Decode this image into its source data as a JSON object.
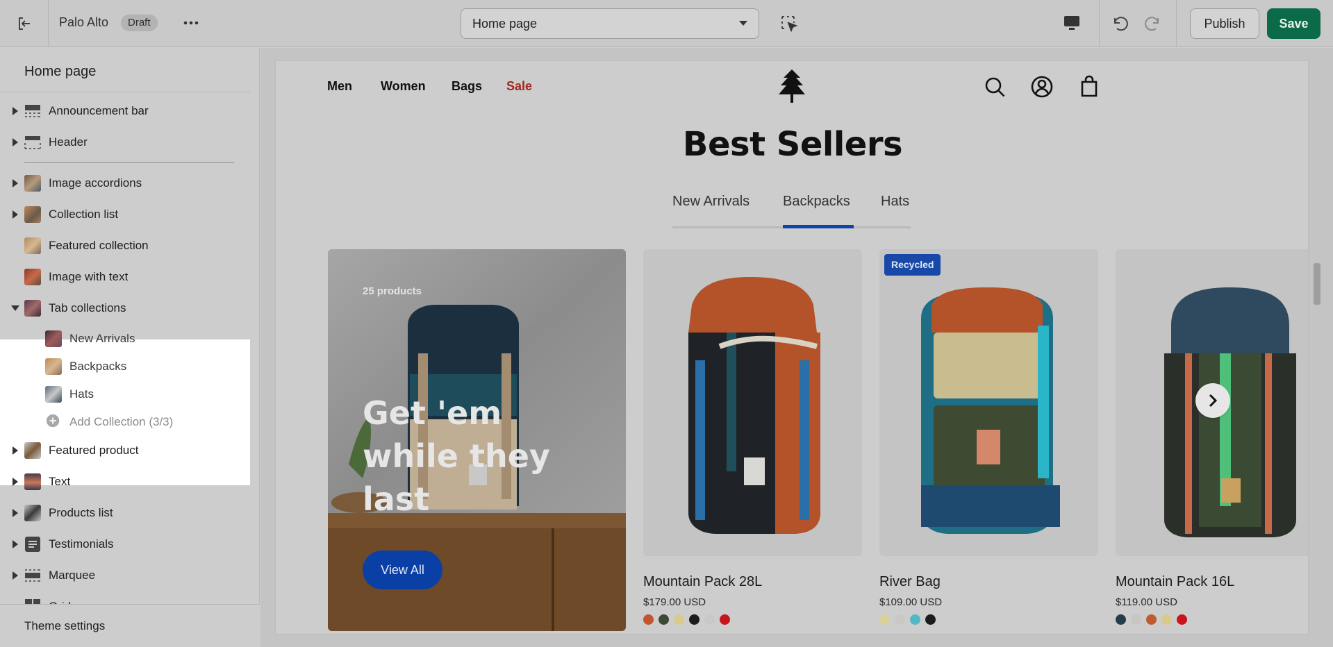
{
  "topbar": {
    "store_name": "Palo Alto",
    "status_badge": "Draft",
    "page_select": "Home page",
    "publish_label": "Publish",
    "save_label": "Save"
  },
  "sidebar": {
    "title": "Home page",
    "header_items": [
      {
        "label": "Announcement bar",
        "icon": "layout-bar-icon"
      },
      {
        "label": "Header",
        "icon": "layout-header-icon"
      }
    ],
    "items": [
      {
        "label": "Image accordions"
      },
      {
        "label": "Collection list"
      },
      {
        "label": "Featured collection"
      },
      {
        "label": "Image with text"
      },
      {
        "label": "Tab collections",
        "expanded": true
      },
      {
        "label": "Featured product"
      },
      {
        "label": "Text"
      },
      {
        "label": "Products list"
      },
      {
        "label": "Testimonials"
      },
      {
        "label": "Marquee"
      },
      {
        "label": "Grid"
      }
    ],
    "sub_items": [
      {
        "label": "New Arrivals"
      },
      {
        "label": "Backpacks"
      },
      {
        "label": "Hats"
      }
    ],
    "add_collection": "Add Collection (3/3)",
    "footer": "Theme settings"
  },
  "preview": {
    "nav": [
      "Men",
      "Women",
      "Bags",
      "Sale"
    ],
    "sale_color": "#a4251f",
    "section_title": "Best Sellers",
    "tabs": [
      "New Arrivals",
      "Backpacks",
      "Hats"
    ],
    "active_tab": "Backpacks",
    "promo": {
      "count": "25 products",
      "headline": "Get 'em while they last",
      "button": "View All"
    },
    "products": [
      {
        "name": "Mountain Pack 28L",
        "price": "$179.00 USD",
        "badge": "",
        "swatches": [
          "#c0552f",
          "#3c4a33",
          "#d8c98d",
          "#1c1c1c",
          "#c8c8c6",
          "#c6151b"
        ]
      },
      {
        "name": "River Bag",
        "price": "$109.00 USD",
        "badge": "Recycled",
        "swatches": [
          "#d9cf9b",
          "#c8c8c4",
          "#52b8c6",
          "#1b1b1b"
        ]
      },
      {
        "name": "Mountain Pack 16L",
        "price": "$119.00 USD",
        "badge": "",
        "swatches": [
          "#253c4a",
          "#c6c6c4",
          "#bf5a31",
          "#d8c98d",
          "#c8161c"
        ]
      }
    ],
    "accent": "#0a46a8",
    "save_color": "#0b6b48"
  }
}
